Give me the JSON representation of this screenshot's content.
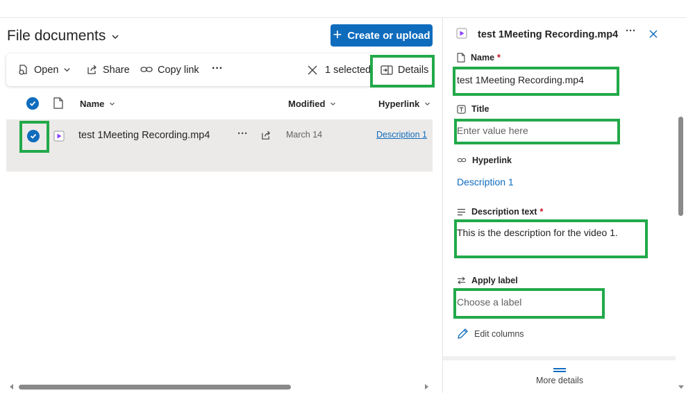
{
  "library": {
    "title": "File documents",
    "create_label": "Create or upload"
  },
  "commands": {
    "open": "Open",
    "share": "Share",
    "copy_link": "Copy link",
    "more": "···",
    "selected": "1 selected",
    "details": "Details"
  },
  "columns": {
    "name": "Name",
    "modified": "Modified",
    "hyperlink": "Hyperlink"
  },
  "rows": [
    {
      "name": "test 1Meeting Recording.mp4",
      "modified": "March 14",
      "hyperlink": "Description 1",
      "selected": true
    }
  ],
  "details_pane": {
    "file_title": "test 1Meeting Recording.mp4",
    "more": "···",
    "fields": {
      "name_label": "Name",
      "name_value": "test 1Meeting Recording.mp4",
      "title_label": "Title",
      "title_placeholder": "Enter value here",
      "hyperlink_label": "Hyperlink",
      "hyperlink_value": "Description 1",
      "description_label": "Description text",
      "description_value": "This is the description for the video 1.",
      "apply_label_label": "Apply label",
      "apply_label_placeholder": "Choose a label"
    },
    "required_marker": "*",
    "edit_columns": "Edit columns",
    "more_details": "More details"
  },
  "colors": {
    "accent": "#0f6cbd",
    "highlight": "#22a94a",
    "selected_row": "#eceae8",
    "required": "#c50f1f",
    "video_icon": "#8a3ffc"
  },
  "icons": [
    "chevron-down-icon",
    "plus-icon",
    "open-icon",
    "share-icon",
    "link-icon",
    "close-icon",
    "details-icon",
    "checkmark-icon",
    "document-icon",
    "video-file-icon",
    "share-arrow-icon",
    "title-field-icon",
    "hyperlink-icon",
    "text-lines-icon",
    "label-swap-icon",
    "pencil-icon",
    "grip-icon"
  ]
}
